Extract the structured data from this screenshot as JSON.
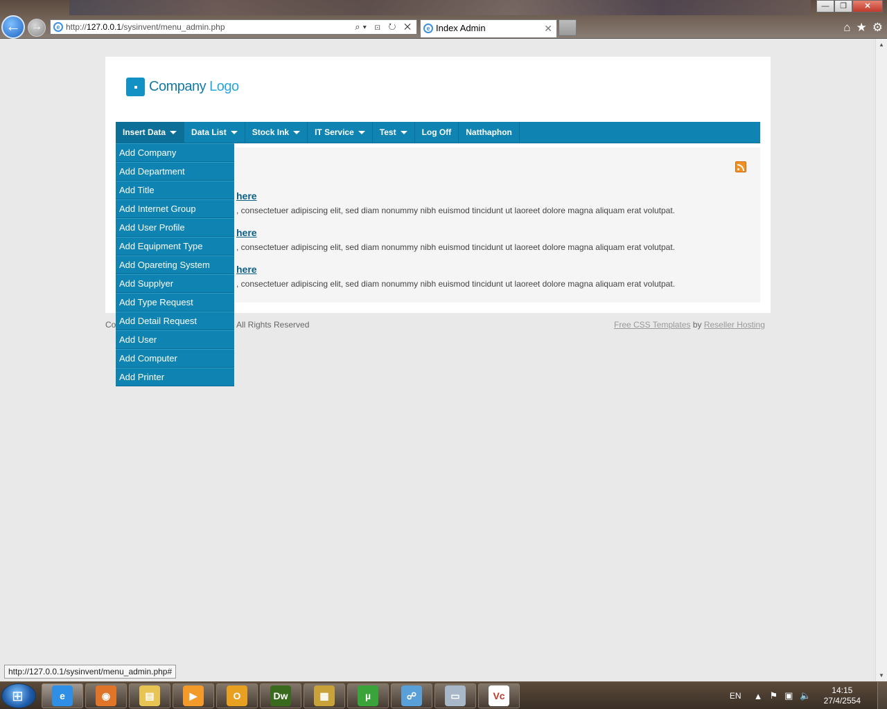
{
  "browser": {
    "address_prefix": "http://",
    "address_host": "127.0.0.1",
    "address_path": "/sysinvent/menu_admin.php",
    "address_tools": "⌕▾ ⊡ ↻ ✕",
    "tab_title": "Index Admin",
    "tab_close": "✕"
  },
  "window_buttons": {
    "minimize": "—",
    "maximize": "❐",
    "close": "✕"
  },
  "logo": {
    "text_main": "Company",
    "text_light": "Logo"
  },
  "menu": {
    "items": [
      {
        "label": "Insert Data",
        "has_caret": true,
        "active": true
      },
      {
        "label": "Data List",
        "has_caret": true
      },
      {
        "label": "Stock Ink",
        "has_caret": true
      },
      {
        "label": "IT Service",
        "has_caret": true
      },
      {
        "label": "Test",
        "has_caret": true
      },
      {
        "label": "Log Off",
        "has_caret": false
      },
      {
        "label": "Natthaphon",
        "has_caret": false
      }
    ]
  },
  "dropdown": {
    "items": [
      "Add Company",
      "Add Department",
      "Add Title",
      "Add Internet Group",
      "Add User Profile",
      "Add Equipment Type",
      "Add Opareting System",
      "Add Supplyer",
      "Add Type Request",
      "Add Detail Request",
      "Add User",
      "Add Computer",
      "Add Printer"
    ]
  },
  "posts": [
    {
      "link": "here",
      "body": ", consectetuer adipiscing elit, sed diam nonummy nibh euismod tincidunt ut laoreet dolore magna aliquam erat volutpat."
    },
    {
      "link": "here",
      "body": ", consectetuer adipiscing elit, sed diam nonummy nibh euismod tincidunt ut laoreet dolore magna aliquam erat volutpat."
    },
    {
      "link": "here",
      "body": ", consectetuer adipiscing elit, sed diam nonummy nibh euismod tincidunt ut laoreet dolore magna aliquam erat volutpat."
    }
  ],
  "footer": {
    "left_prefix": "Co",
    "rights": "All Rights Reserved",
    "templates_link": "Free CSS Templates",
    "by": " by ",
    "hosting_link": "Reseller Hosting"
  },
  "status_url": "http://127.0.0.1/sysinvent/menu_admin.php#",
  "taskbar": {
    "apps": [
      {
        "name": "ie",
        "glyph": "e",
        "color": "#2f8fe6"
      },
      {
        "name": "firefox",
        "glyph": "◉",
        "color": "#e0752a"
      },
      {
        "name": "explorer",
        "glyph": "▤",
        "color": "#e8c455"
      },
      {
        "name": "media",
        "glyph": "▶",
        "color": "#f39b2a"
      },
      {
        "name": "outlook",
        "glyph": "O",
        "color": "#e8a020"
      },
      {
        "name": "dreamweaver",
        "glyph": "Dw",
        "color": "#3a6a1e"
      },
      {
        "name": "files",
        "glyph": "▦",
        "color": "#c9a23a"
      },
      {
        "name": "utorrent",
        "glyph": "µ",
        "color": "#3aa33a"
      },
      {
        "name": "network",
        "glyph": "☍",
        "color": "#5aa0d8"
      },
      {
        "name": "window",
        "glyph": "▭",
        "color": "#a8b8c8"
      },
      {
        "name": "vnc",
        "glyph": "Vc",
        "color": "#ffffff"
      }
    ],
    "lang": "EN",
    "time": "14:15",
    "date": "27/4/2554"
  }
}
